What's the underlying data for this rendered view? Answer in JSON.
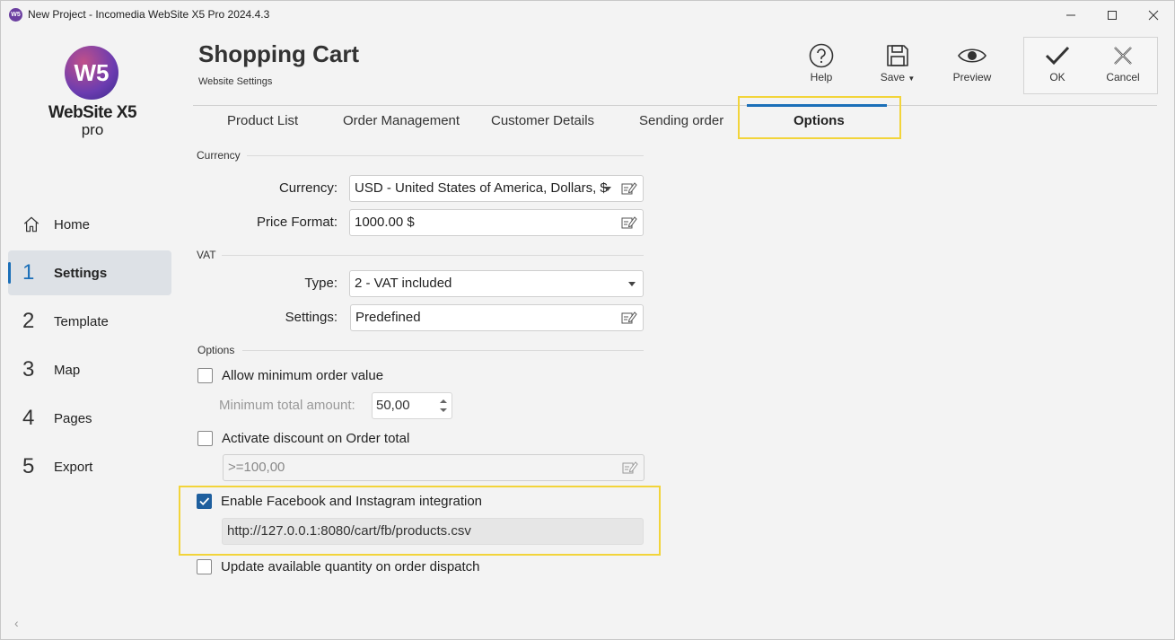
{
  "titlebar": {
    "app_icon": "W5",
    "title": "New Project - Incomedia WebSite X5 Pro 2024.4.3"
  },
  "logo": {
    "mark": "W5",
    "name": "WebSite X5",
    "edition": "pro"
  },
  "nav": [
    {
      "num": "",
      "label": "Home",
      "icon": "home-icon"
    },
    {
      "num": "1",
      "label": "Settings",
      "active": true
    },
    {
      "num": "2",
      "label": "Template"
    },
    {
      "num": "3",
      "label": "Map"
    },
    {
      "num": "4",
      "label": "Pages"
    },
    {
      "num": "5",
      "label": "Export"
    }
  ],
  "header": {
    "title": "Shopping Cart",
    "subtitle": "Website Settings"
  },
  "toolbar": {
    "help": "Help",
    "save": "Save",
    "preview": "Preview",
    "ok": "OK",
    "cancel": "Cancel"
  },
  "tabs": [
    "Product List",
    "Order Management",
    "Customer Details",
    "Sending order",
    "Options"
  ],
  "currency_section": {
    "label": "Currency",
    "currency_label": "Currency:",
    "currency_value": "USD - United States of America, Dollars, $",
    "price_format_label": "Price Format:",
    "price_format_value": "1000.00 $"
  },
  "vat_section": {
    "label": "VAT",
    "type_label": "Type:",
    "type_value": "2 - VAT included",
    "settings_label": "Settings:",
    "settings_value": "Predefined"
  },
  "options_section": {
    "label": "Options",
    "min_order_label": "Allow minimum order value",
    "min_order_checked": false,
    "min_total_label": "Minimum total amount:",
    "min_total_value": "50,00",
    "discount_label": "Activate discount on Order total",
    "discount_checked": false,
    "discount_value": ">=100,00",
    "facebook_label": "Enable Facebook and Instagram integration",
    "facebook_checked": true,
    "facebook_url": "http://127.0.0.1:8080/cart/fb/products.csv",
    "update_qty_label": "Update available quantity on order dispatch",
    "update_qty_checked": false
  },
  "colors": {
    "accent": "#1b6fb8",
    "highlight": "#f2d43a",
    "checkbox_checked": "#1e5f9e"
  }
}
